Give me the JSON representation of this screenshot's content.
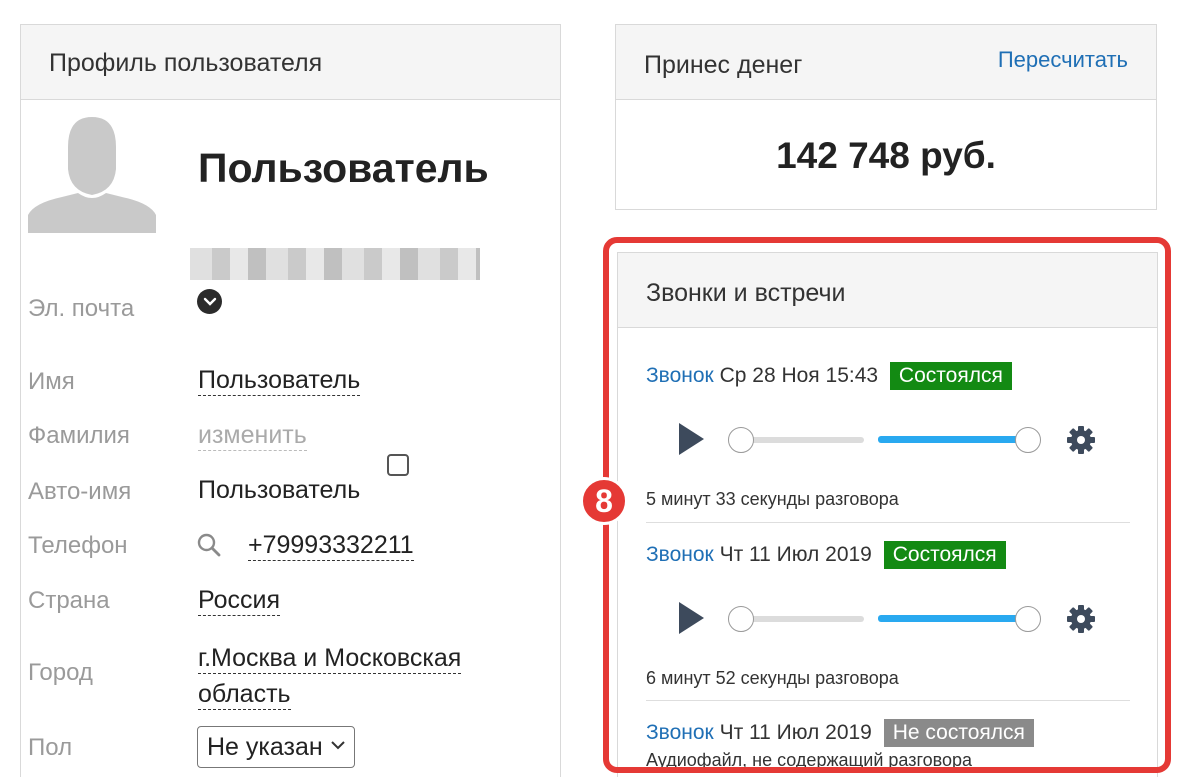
{
  "profile": {
    "title": "Профиль пользователя",
    "user_name": "Пользователь",
    "fields": {
      "email_label": "Эл. почта",
      "first_name_label": "Имя",
      "first_name_value": "Пользователь",
      "last_name_label": "Фамилия",
      "last_name_value": "изменить",
      "auto_name_label": "Авто-имя",
      "auto_name_value": "Пользователь",
      "phone_label": "Телефон",
      "phone_value": "+79993332211",
      "country_label": "Страна",
      "country_value": "Россия",
      "city_label": "Город",
      "city_value_line1": "г.Москва и Московская",
      "city_value_line2": "область",
      "gender_label": "Пол",
      "gender_value": "Не указан"
    }
  },
  "money": {
    "title": "Принес денег",
    "recalc_label": "Пересчитать",
    "value": "142 748 руб."
  },
  "calls": {
    "title": "Звонки и встречи",
    "step_number": "8",
    "items": [
      {
        "type": "Звонок",
        "date": "Ср 28 Ноя 15:43",
        "status": "Состоялся",
        "duration": "5 минут 33 секунды разговора"
      },
      {
        "type": "Звонок",
        "date": "Чт 11 Июл 2019",
        "status": "Состоялся",
        "duration": "6 минут 52 секунды разговора"
      },
      {
        "type": "Звонок",
        "date": "Чт 11 Июл 2019",
        "status": "Не состоялся",
        "note": "Аудиофайл, не содержащий разговора"
      }
    ]
  },
  "colors": {
    "link": "#1f6fb5",
    "status_ok": "#138a13",
    "status_fail": "#8a8a8a",
    "highlight": "#e53935",
    "volume": "#29a9f0"
  },
  "icons": [
    "avatar-placeholder-icon",
    "chevron-down-icon",
    "search-icon",
    "play-icon",
    "gear-icon"
  ]
}
